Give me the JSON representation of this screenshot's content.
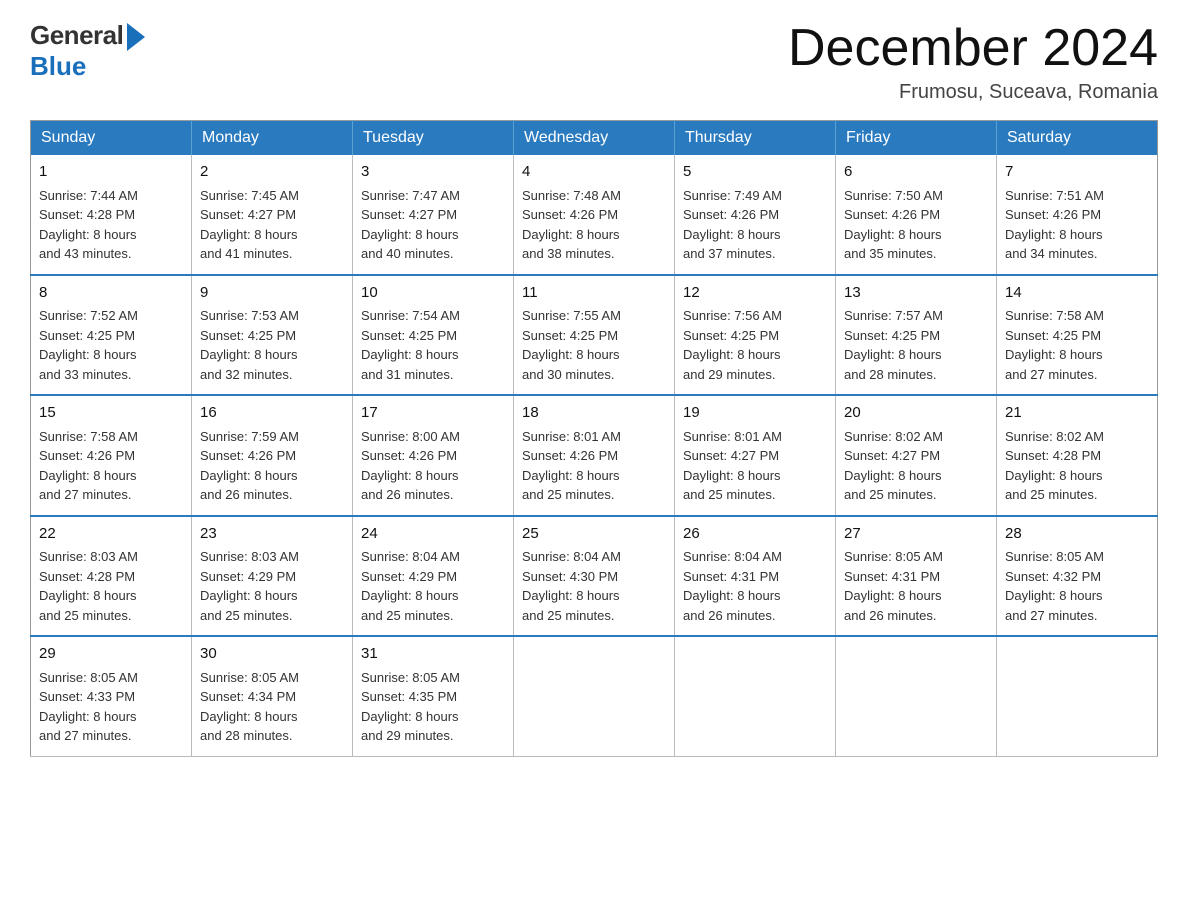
{
  "logo": {
    "general": "General",
    "blue": "Blue"
  },
  "header": {
    "month_year": "December 2024",
    "location": "Frumosu, Suceava, Romania"
  },
  "days_of_week": [
    "Sunday",
    "Monday",
    "Tuesday",
    "Wednesday",
    "Thursday",
    "Friday",
    "Saturday"
  ],
  "weeks": [
    [
      {
        "day": "1",
        "sunrise": "7:44 AM",
        "sunset": "4:28 PM",
        "daylight": "8 hours and 43 minutes."
      },
      {
        "day": "2",
        "sunrise": "7:45 AM",
        "sunset": "4:27 PM",
        "daylight": "8 hours and 41 minutes."
      },
      {
        "day": "3",
        "sunrise": "7:47 AM",
        "sunset": "4:27 PM",
        "daylight": "8 hours and 40 minutes."
      },
      {
        "day": "4",
        "sunrise": "7:48 AM",
        "sunset": "4:26 PM",
        "daylight": "8 hours and 38 minutes."
      },
      {
        "day": "5",
        "sunrise": "7:49 AM",
        "sunset": "4:26 PM",
        "daylight": "8 hours and 37 minutes."
      },
      {
        "day": "6",
        "sunrise": "7:50 AM",
        "sunset": "4:26 PM",
        "daylight": "8 hours and 35 minutes."
      },
      {
        "day": "7",
        "sunrise": "7:51 AM",
        "sunset": "4:26 PM",
        "daylight": "8 hours and 34 minutes."
      }
    ],
    [
      {
        "day": "8",
        "sunrise": "7:52 AM",
        "sunset": "4:25 PM",
        "daylight": "8 hours and 33 minutes."
      },
      {
        "day": "9",
        "sunrise": "7:53 AM",
        "sunset": "4:25 PM",
        "daylight": "8 hours and 32 minutes."
      },
      {
        "day": "10",
        "sunrise": "7:54 AM",
        "sunset": "4:25 PM",
        "daylight": "8 hours and 31 minutes."
      },
      {
        "day": "11",
        "sunrise": "7:55 AM",
        "sunset": "4:25 PM",
        "daylight": "8 hours and 30 minutes."
      },
      {
        "day": "12",
        "sunrise": "7:56 AM",
        "sunset": "4:25 PM",
        "daylight": "8 hours and 29 minutes."
      },
      {
        "day": "13",
        "sunrise": "7:57 AM",
        "sunset": "4:25 PM",
        "daylight": "8 hours and 28 minutes."
      },
      {
        "day": "14",
        "sunrise": "7:58 AM",
        "sunset": "4:25 PM",
        "daylight": "8 hours and 27 minutes."
      }
    ],
    [
      {
        "day": "15",
        "sunrise": "7:58 AM",
        "sunset": "4:26 PM",
        "daylight": "8 hours and 27 minutes."
      },
      {
        "day": "16",
        "sunrise": "7:59 AM",
        "sunset": "4:26 PM",
        "daylight": "8 hours and 26 minutes."
      },
      {
        "day": "17",
        "sunrise": "8:00 AM",
        "sunset": "4:26 PM",
        "daylight": "8 hours and 26 minutes."
      },
      {
        "day": "18",
        "sunrise": "8:01 AM",
        "sunset": "4:26 PM",
        "daylight": "8 hours and 25 minutes."
      },
      {
        "day": "19",
        "sunrise": "8:01 AM",
        "sunset": "4:27 PM",
        "daylight": "8 hours and 25 minutes."
      },
      {
        "day": "20",
        "sunrise": "8:02 AM",
        "sunset": "4:27 PM",
        "daylight": "8 hours and 25 minutes."
      },
      {
        "day": "21",
        "sunrise": "8:02 AM",
        "sunset": "4:28 PM",
        "daylight": "8 hours and 25 minutes."
      }
    ],
    [
      {
        "day": "22",
        "sunrise": "8:03 AM",
        "sunset": "4:28 PM",
        "daylight": "8 hours and 25 minutes."
      },
      {
        "day": "23",
        "sunrise": "8:03 AM",
        "sunset": "4:29 PM",
        "daylight": "8 hours and 25 minutes."
      },
      {
        "day": "24",
        "sunrise": "8:04 AM",
        "sunset": "4:29 PM",
        "daylight": "8 hours and 25 minutes."
      },
      {
        "day": "25",
        "sunrise": "8:04 AM",
        "sunset": "4:30 PM",
        "daylight": "8 hours and 25 minutes."
      },
      {
        "day": "26",
        "sunrise": "8:04 AM",
        "sunset": "4:31 PM",
        "daylight": "8 hours and 26 minutes."
      },
      {
        "day": "27",
        "sunrise": "8:05 AM",
        "sunset": "4:31 PM",
        "daylight": "8 hours and 26 minutes."
      },
      {
        "day": "28",
        "sunrise": "8:05 AM",
        "sunset": "4:32 PM",
        "daylight": "8 hours and 27 minutes."
      }
    ],
    [
      {
        "day": "29",
        "sunrise": "8:05 AM",
        "sunset": "4:33 PM",
        "daylight": "8 hours and 27 minutes."
      },
      {
        "day": "30",
        "sunrise": "8:05 AM",
        "sunset": "4:34 PM",
        "daylight": "8 hours and 28 minutes."
      },
      {
        "day": "31",
        "sunrise": "8:05 AM",
        "sunset": "4:35 PM",
        "daylight": "8 hours and 29 minutes."
      },
      null,
      null,
      null,
      null
    ]
  ],
  "labels": {
    "sunrise": "Sunrise:",
    "sunset": "Sunset:",
    "daylight": "Daylight:"
  }
}
